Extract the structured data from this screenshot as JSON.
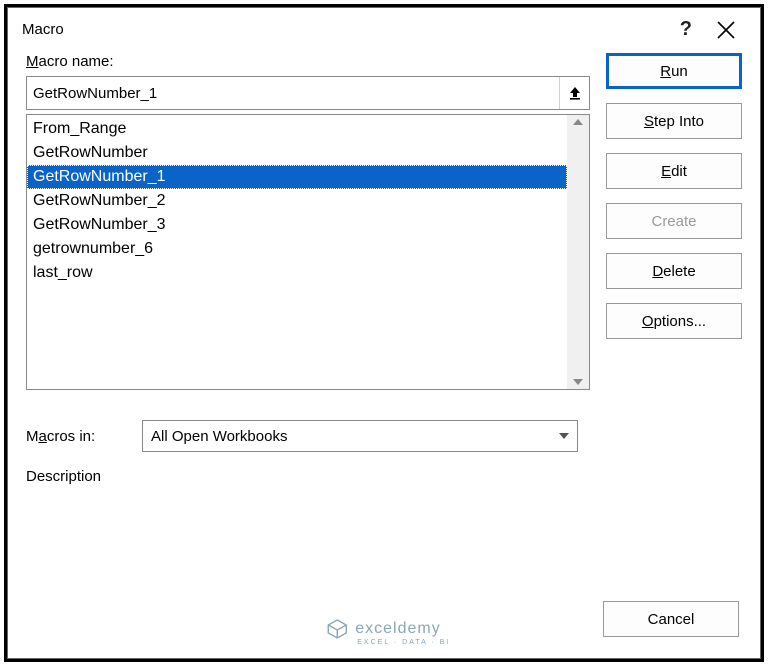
{
  "title": "Macro",
  "labels": {
    "macro_name": "Macro name:",
    "macros_in": "Macros in:",
    "description": "Description"
  },
  "macro_name_value": "GetRowNumber_1",
  "macro_list": {
    "items": [
      "From_Range",
      "GetRowNumber",
      "GetRowNumber_1",
      "GetRowNumber_2",
      "GetRowNumber_3",
      "getrownumber_6",
      "last_row"
    ],
    "selected_index": 2
  },
  "macros_in_value": "All Open Workbooks",
  "buttons": {
    "run": "Run",
    "step_into": "Step Into",
    "edit": "Edit",
    "create": "Create",
    "delete": "Delete",
    "options": "Options...",
    "cancel": "Cancel"
  },
  "watermark": {
    "text": "exceldemy",
    "sub": "EXCEL · DATA · BI"
  }
}
